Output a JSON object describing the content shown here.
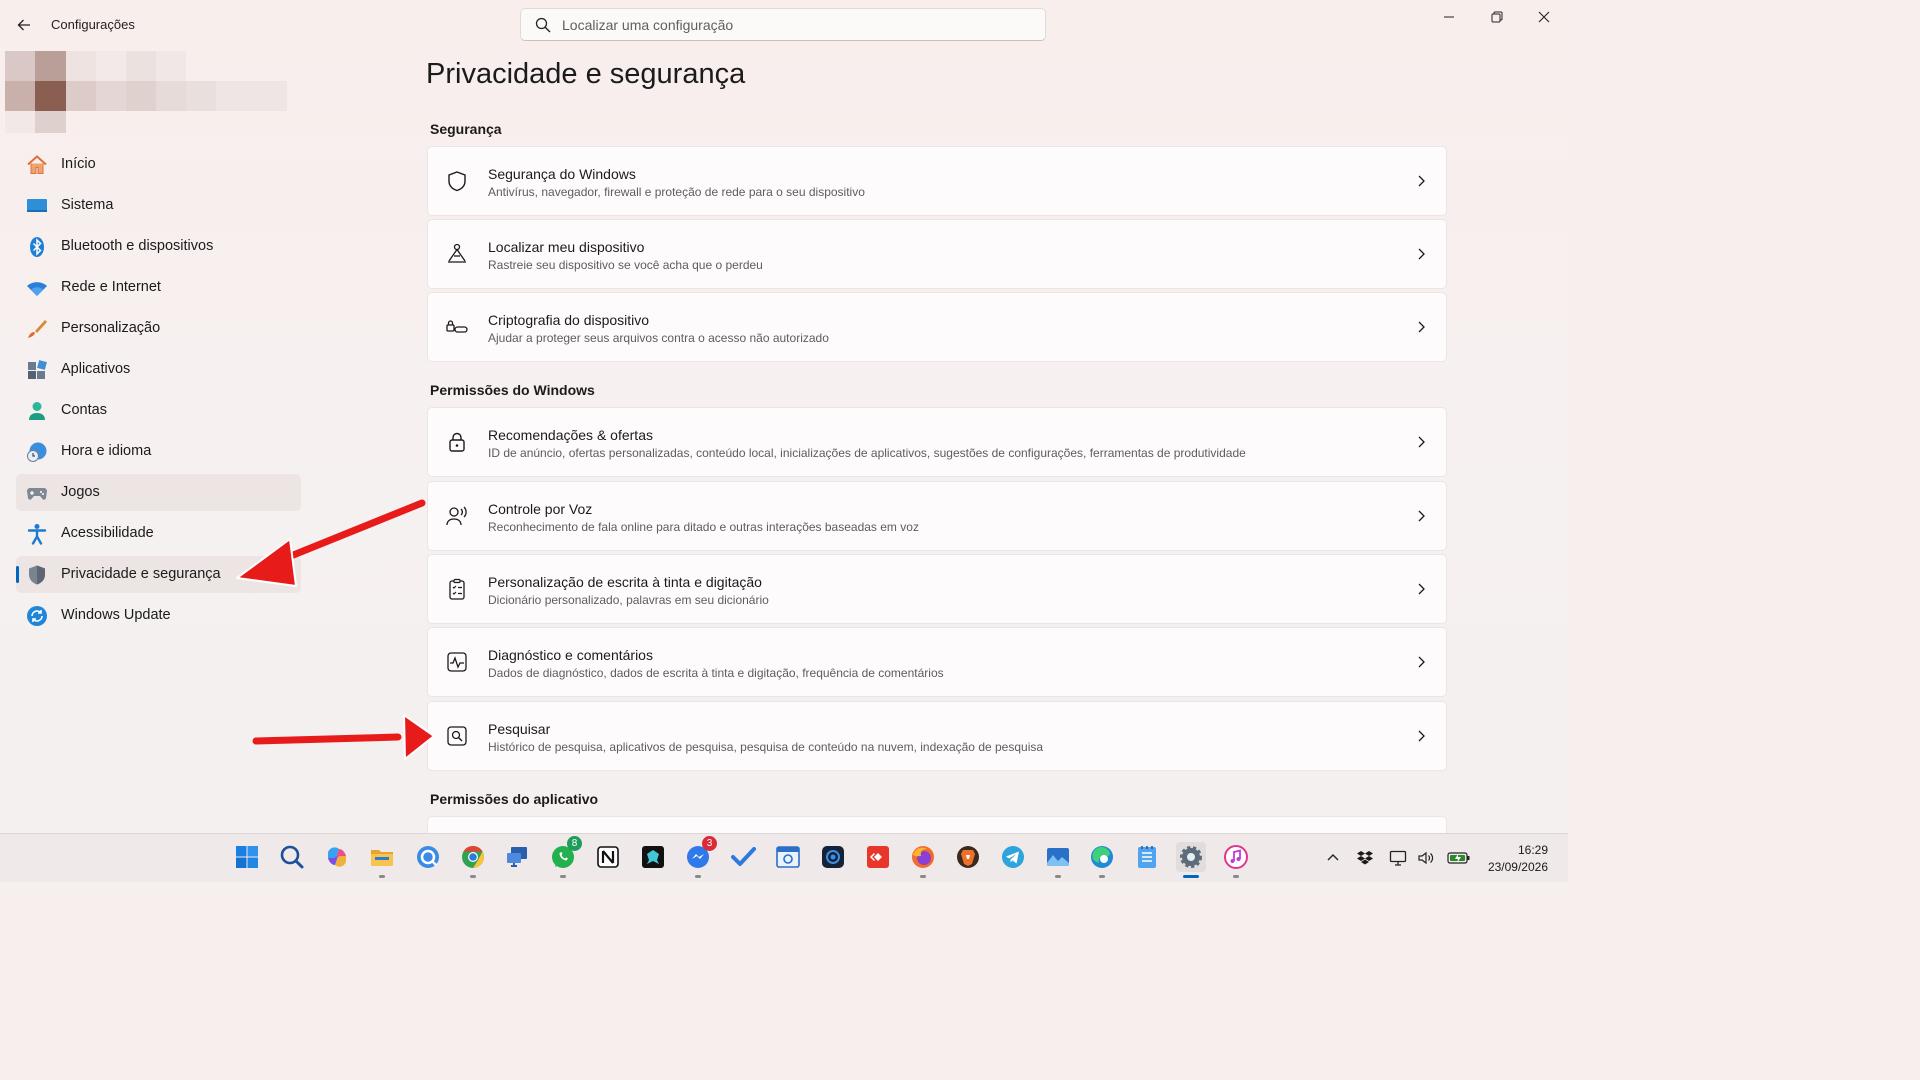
{
  "window": {
    "title": "Configurações",
    "controls": [
      "minimize",
      "restore",
      "close"
    ]
  },
  "search": {
    "placeholder": "Localizar uma configuração",
    "icon": "search-icon"
  },
  "sidebar": {
    "items": [
      {
        "label": "Início",
        "icon": "home-icon"
      },
      {
        "label": "Sistema",
        "icon": "monitor-icon"
      },
      {
        "label": "Bluetooth e dispositivos",
        "icon": "bluetooth-icon"
      },
      {
        "label": "Rede e Internet",
        "icon": "wifi-icon"
      },
      {
        "label": "Personalização",
        "icon": "brush-icon"
      },
      {
        "label": "Aplicativos",
        "icon": "apps-icon"
      },
      {
        "label": "Contas",
        "icon": "person-icon"
      },
      {
        "label": "Hora e idioma",
        "icon": "clock-globe-icon"
      },
      {
        "label": "Jogos",
        "icon": "gamepad-icon"
      },
      {
        "label": "Acessibilidade",
        "icon": "accessibility-icon"
      },
      {
        "label": "Privacidade e segurança",
        "icon": "shield-icon",
        "selected": true
      },
      {
        "label": "Windows Update",
        "icon": "update-icon"
      }
    ]
  },
  "main": {
    "title": "Privacidade e segurança",
    "sections": [
      {
        "header": "Segurança",
        "cards": [
          {
            "title": "Segurança do Windows",
            "subtitle": "Antivírus, navegador, firewall e proteção de rede para o seu dispositivo",
            "icon": "shield-outline-icon"
          },
          {
            "title": "Localizar meu dispositivo",
            "subtitle": "Rastreie seu dispositivo se você acha que o perdeu",
            "icon": "find-device-icon"
          },
          {
            "title": "Criptografia do dispositivo",
            "subtitle": "Ajudar a proteger seus arquivos contra o acesso não autorizado",
            "icon": "lock-key-icon"
          }
        ]
      },
      {
        "header": "Permissões do Windows",
        "cards": [
          {
            "title": "Recomendações & ofertas",
            "subtitle": "ID de anúncio, ofertas personalizadas, conteúdo local, inicializações de aplicativos, sugestões de configurações, ferramentas de produtividade",
            "icon": "lock-icon"
          },
          {
            "title": "Controle por Voz",
            "subtitle": "Reconhecimento de fala online para ditado e outras interações baseadas em voz",
            "icon": "voice-icon"
          },
          {
            "title": "Personalização de escrita à tinta e digitação",
            "subtitle": "Dicionário personalizado, palavras em seu dicionário",
            "icon": "clipboard-list-icon"
          },
          {
            "title": "Diagnóstico e comentários",
            "subtitle": "Dados de diagnóstico, dados de escrita à tinta e digitação, frequência de comentários",
            "icon": "activity-icon"
          },
          {
            "title": "Pesquisar",
            "subtitle": "Histórico de pesquisa, aplicativos de pesquisa, pesquisa de conteúdo na nuvem, indexação de pesquisa",
            "icon": "search-box-icon"
          }
        ]
      },
      {
        "header": "Permissões do aplicativo",
        "cards": []
      }
    ]
  },
  "annotations": {
    "arrow_color": "#e81b1b"
  },
  "taskbar": {
    "apps": [
      {
        "name": "start-icon"
      },
      {
        "name": "search-icon"
      },
      {
        "name": "copilot-icon"
      },
      {
        "name": "file-explorer-icon"
      },
      {
        "name": "quick-assist-icon"
      },
      {
        "name": "chrome-icon"
      },
      {
        "name": "remote-desktop-icon"
      },
      {
        "name": "whatsapp-icon",
        "badge": "8"
      },
      {
        "name": "notion-icon"
      },
      {
        "name": "app-butterfly-icon"
      },
      {
        "name": "messenger-icon",
        "badge": "3"
      },
      {
        "name": "todo-icon"
      },
      {
        "name": "calendar-app-icon"
      },
      {
        "name": "camera-app-icon"
      },
      {
        "name": "anydesk-icon"
      },
      {
        "name": "firefox-icon"
      },
      {
        "name": "brave-icon"
      },
      {
        "name": "telegram-icon"
      },
      {
        "name": "photos-icon"
      },
      {
        "name": "edge-icon"
      },
      {
        "name": "notepad-icon"
      },
      {
        "name": "settings-icon",
        "active": true
      },
      {
        "name": "itunes-icon"
      }
    ],
    "tray": [
      "chevron-up-icon",
      "dropbox-icon",
      "display-icon",
      "volume-icon",
      "battery-icon"
    ],
    "time": "16:29",
    "date": "23/09/2026"
  }
}
